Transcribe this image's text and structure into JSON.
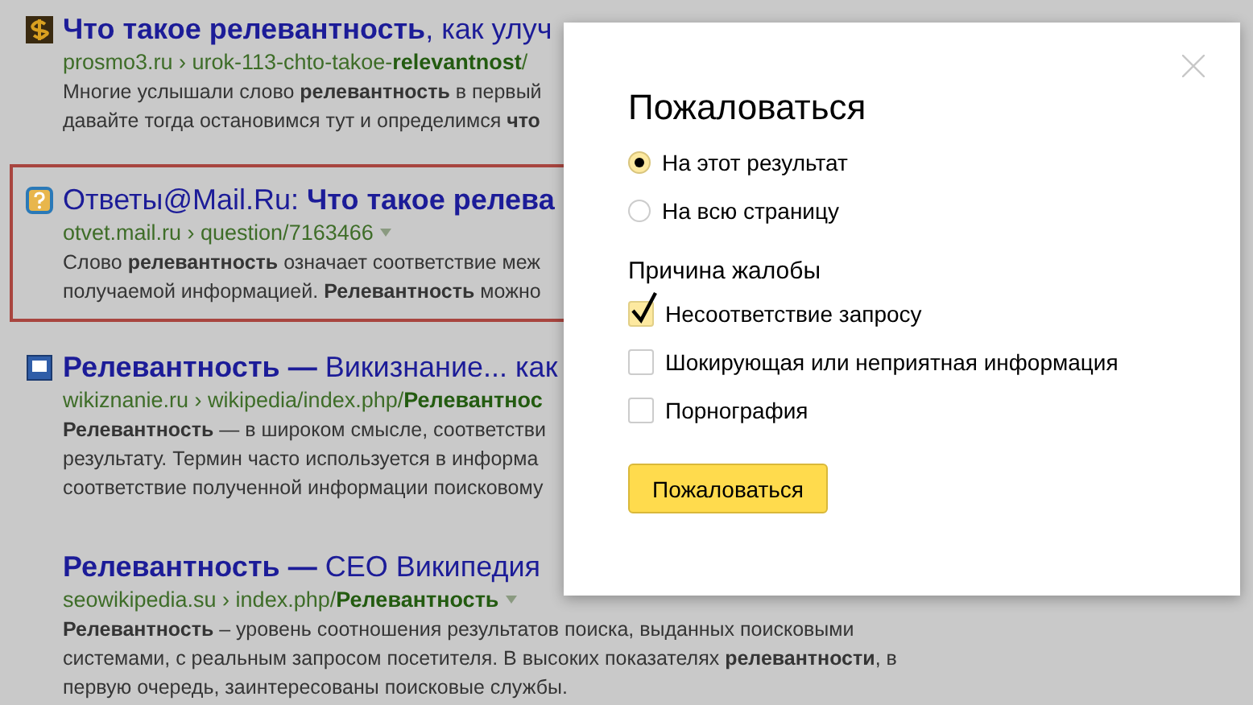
{
  "results": [
    {
      "highlighted": false,
      "title": "**Что такое релевантность**, как улуч",
      "url": "prosmo3.ru › urok-113-chto-takoe-**relevantnost**/",
      "has_menu": false,
      "snippet": [
        "Многие услышали слово **релевантность** в первый",
        "давайте тогда остановимся тут и определимся **что**"
      ]
    },
    {
      "highlighted": true,
      "title": "Ответы@Mail.Ru: **Что такое релева**",
      "url": "otvet.mail.ru › question/7163466",
      "has_menu": true,
      "snippet": [
        "Слово **релевантность** означает соответствие меж",
        "получаемой информацией. **Релевантность** можно"
      ]
    },
    {
      "highlighted": false,
      "title": "**Релевантность —** Викизнание... как",
      "url": "wikiznanie.ru › wikipedia/index.php/**Релевантнос**",
      "has_menu": false,
      "snippet": [
        "**Релевантность** — в широком смысле, соответстви",
        "результату. Термин часто используется в информа",
        "соответствие полученной информации поисковому"
      ]
    },
    {
      "highlighted": false,
      "title": "**Релевантность —** СЕО Википедия",
      "url": "seowikipedia.su › index.php/**Релевантность**",
      "has_menu": true,
      "snippet": [
        "**Релевантность** – уровень соотношения результатов поиска, выданных поисковыми",
        "системами, с реальным запросом посетителя. В высоких показателях **релевантности**, в",
        "первую очередь, заинтересованы поисковые службы."
      ]
    }
  ],
  "dialog": {
    "title": "Пожаловаться",
    "scope": [
      {
        "label": "На этот результат",
        "selected": true
      },
      {
        "label": "На всю страницу",
        "selected": false
      }
    ],
    "reason_heading": "Причина жалобы",
    "reasons": [
      {
        "label": "Несоответствие запросу",
        "checked": true
      },
      {
        "label": "Шокирующая или неприятная информация",
        "checked": false
      },
      {
        "label": "Порнография",
        "checked": false
      }
    ],
    "submit": "Пожаловаться"
  }
}
